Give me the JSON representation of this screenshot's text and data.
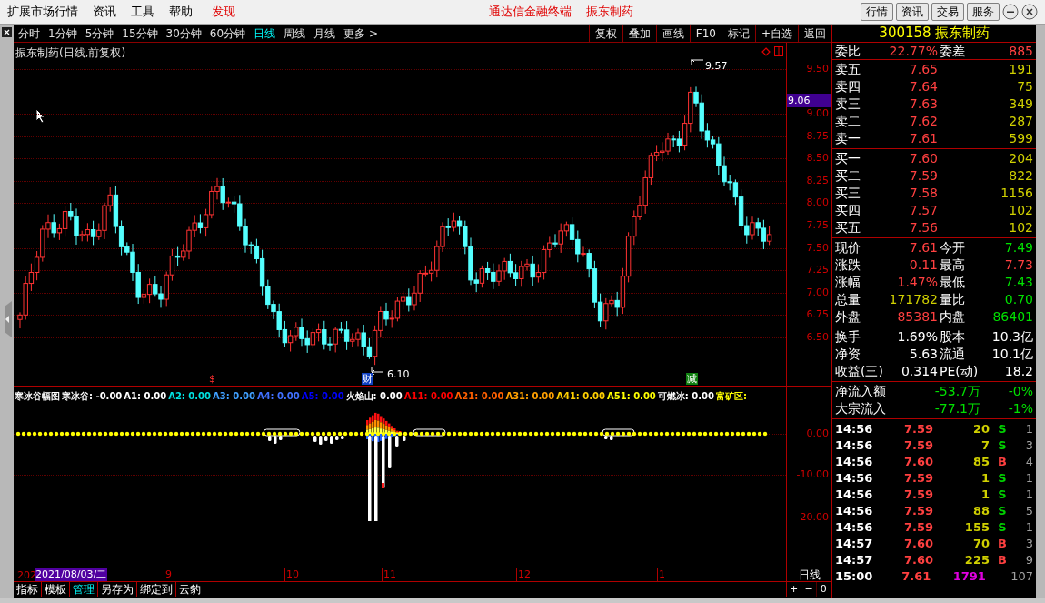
{
  "menu": {
    "items": [
      {
        "label": "扩展市场行情",
        "kind": "plain"
      },
      {
        "label": "资讯",
        "kind": "plain"
      },
      {
        "label": "工具",
        "kind": "plain"
      },
      {
        "label": "帮助",
        "kind": "plain"
      },
      {
        "label": "发现",
        "kind": "accent"
      }
    ],
    "title": "通达信金融终端",
    "stock": "振东制药",
    "buttons": [
      "行情",
      "资讯",
      "交易",
      "服务"
    ]
  },
  "periods": [
    {
      "label": "分时",
      "selected": false
    },
    {
      "label": "1分钟",
      "selected": false
    },
    {
      "label": "5分钟",
      "selected": false
    },
    {
      "label": "15分钟",
      "selected": false
    },
    {
      "label": "30分钟",
      "selected": false
    },
    {
      "label": "60分钟",
      "selected": false
    },
    {
      "label": "日线",
      "selected": true
    },
    {
      "label": "周线",
      "selected": false
    },
    {
      "label": "月线",
      "selected": false
    },
    {
      "label": "更多 >",
      "selected": false
    }
  ],
  "toolbar": [
    "复权",
    "叠加",
    "画线",
    "F10",
    "标记",
    "+自选",
    "返回"
  ],
  "chart": {
    "title": "振东制药(日线,前复权)",
    "high_label": "9.57",
    "low_label": "6.10",
    "price_ticks": [
      "9.50",
      "9.00",
      "8.75",
      "8.50",
      "8.25",
      "8.00",
      "7.75",
      "7.50",
      "7.25",
      "7.00",
      "6.75",
      "6.50"
    ],
    "cursor_price": "9.06",
    "markers": [
      {
        "text": "$",
        "kind": "dividend"
      },
      {
        "text": "财",
        "kind": "report"
      },
      {
        "text": "减",
        "kind": "reduce"
      }
    ]
  },
  "indicator": {
    "legend": [
      {
        "text": "寒冰谷幅图",
        "color": "#ffffff"
      },
      {
        "text": "寒冰谷: -0.00",
        "color": "#ffffff"
      },
      {
        "text": "A1: 0.00",
        "color": "#ffffff"
      },
      {
        "text": "A2: 0.00",
        "color": "#00e0e0"
      },
      {
        "text": "A3: 0.00",
        "color": "#40a0ff"
      },
      {
        "text": "A4: 0.00",
        "color": "#4070ff"
      },
      {
        "text": "A5: 0.00",
        "color": "#0000ff"
      },
      {
        "text": "火焰山: 0.00",
        "color": "#ffffff"
      },
      {
        "text": "A11: 0.00",
        "color": "#ff0000"
      },
      {
        "text": "A21: 0.00",
        "color": "#ff6000"
      },
      {
        "text": "A31: 0.00",
        "color": "#ffa000"
      },
      {
        "text": "A41: 0.00",
        "color": "#ffd000"
      },
      {
        "text": "A51: 0.00",
        "color": "#ffff00"
      },
      {
        "text": "可燃冰: 0.00",
        "color": "#ffffff"
      },
      {
        "text": "富矿区:",
        "color": "#ffff00"
      }
    ],
    "ticks": [
      "0.00",
      "-10.00",
      "-20.00"
    ]
  },
  "dates": {
    "cut": "202",
    "cursor": "2021/08/03/二",
    "months": [
      "9",
      "10",
      "11",
      "12",
      "1"
    ],
    "period": "日线"
  },
  "bottom_tabs": [
    {
      "label": "指标",
      "selected": false
    },
    {
      "label": "模板",
      "selected": false
    },
    {
      "label": "管理",
      "selected": true
    },
    {
      "label": "另存为",
      "selected": false
    },
    {
      "label": "绑定到",
      "selected": false
    },
    {
      "label": "云豹",
      "selected": false
    }
  ],
  "zoom_buttons": [
    "+",
    "−",
    "0"
  ],
  "quote": {
    "code": "300158",
    "name": "振东制药",
    "ratio_label": "委比",
    "ratio": "22.77%",
    "diff_label": "委差",
    "diff": "885",
    "asks": [
      {
        "label": "卖五",
        "price": "7.65",
        "volume": "191"
      },
      {
        "label": "卖四",
        "price": "7.64",
        "volume": "75"
      },
      {
        "label": "卖三",
        "price": "7.63",
        "volume": "349"
      },
      {
        "label": "卖二",
        "price": "7.62",
        "volume": "287"
      },
      {
        "label": "卖一",
        "price": "7.61",
        "volume": "599"
      }
    ],
    "bids": [
      {
        "label": "买一",
        "price": "7.60",
        "volume": "204"
      },
      {
        "label": "买二",
        "price": "7.59",
        "volume": "822"
      },
      {
        "label": "买三",
        "price": "7.58",
        "volume": "1156"
      },
      {
        "label": "买四",
        "price": "7.57",
        "volume": "102"
      },
      {
        "label": "买五",
        "price": "7.56",
        "volume": "102"
      }
    ],
    "stats": [
      {
        "cells": [
          {
            "label": "现价",
            "value": "7.61",
            "color": "#ff4040"
          },
          {
            "label": "今开",
            "value": "7.49",
            "color": "#00e000"
          }
        ]
      },
      {
        "cells": [
          {
            "label": "涨跌",
            "value": "0.11",
            "color": "#ff4040"
          },
          {
            "label": "最高",
            "value": "7.73",
            "color": "#ff4040"
          }
        ]
      },
      {
        "cells": [
          {
            "label": "涨幅",
            "value": "1.47%",
            "color": "#ff4040"
          },
          {
            "label": "最低",
            "value": "7.43",
            "color": "#00e000"
          }
        ]
      },
      {
        "cells": [
          {
            "label": "总量",
            "value": "171782",
            "color": "#d0d000"
          },
          {
            "label": "量比",
            "value": "0.70",
            "color": "#00e000"
          }
        ]
      },
      {
        "cells": [
          {
            "label": "外盘",
            "value": "85381",
            "color": "#ff4040"
          },
          {
            "label": "内盘",
            "value": "86401",
            "color": "#00e000"
          }
        ]
      }
    ],
    "fundamentals": [
      {
        "cells": [
          {
            "label": "换手",
            "value": "1.69%"
          },
          {
            "label": "股本",
            "value": "10.3亿"
          }
        ]
      },
      {
        "cells": [
          {
            "label": "净资",
            "value": "5.63"
          },
          {
            "label": "流通",
            "value": "10.1亿"
          }
        ]
      },
      {
        "cells": [
          {
            "label": "收益(三)",
            "value": "0.314"
          },
          {
            "label": "PE(动)",
            "value": "18.2"
          }
        ]
      }
    ],
    "flows": [
      {
        "label": "净流入额",
        "amount": "-53.7万",
        "pct": "-0%"
      },
      {
        "label": "大宗流入",
        "amount": "-77.1万",
        "pct": "-1%"
      }
    ],
    "trades": [
      {
        "time": "14:56",
        "price": "7.59",
        "volume": "20",
        "side": "S",
        "count": "1",
        "kind": "sell"
      },
      {
        "time": "14:56",
        "price": "7.59",
        "volume": "7",
        "side": "S",
        "count": "3",
        "kind": "sell"
      },
      {
        "time": "14:56",
        "price": "7.60",
        "volume": "85",
        "side": "B",
        "count": "4",
        "kind": "buy"
      },
      {
        "time": "14:56",
        "price": "7.59",
        "volume": "1",
        "side": "S",
        "count": "1",
        "kind": "sell"
      },
      {
        "time": "14:56",
        "price": "7.59",
        "volume": "1",
        "side": "S",
        "count": "1",
        "kind": "sell"
      },
      {
        "time": "14:56",
        "price": "7.59",
        "volume": "88",
        "side": "S",
        "count": "5",
        "kind": "sell"
      },
      {
        "time": "14:56",
        "price": "7.59",
        "volume": "155",
        "side": "S",
        "count": "1",
        "kind": "sell"
      },
      {
        "time": "14:57",
        "price": "7.60",
        "volume": "70",
        "side": "B",
        "count": "3",
        "kind": "buy"
      },
      {
        "time": "14:57",
        "price": "7.60",
        "volume": "225",
        "side": "B",
        "count": "9",
        "kind": "buy"
      },
      {
        "time": "15:00",
        "price": "7.61",
        "volume": "1791",
        "count": "107",
        "kind": "closing"
      }
    ]
  }
}
